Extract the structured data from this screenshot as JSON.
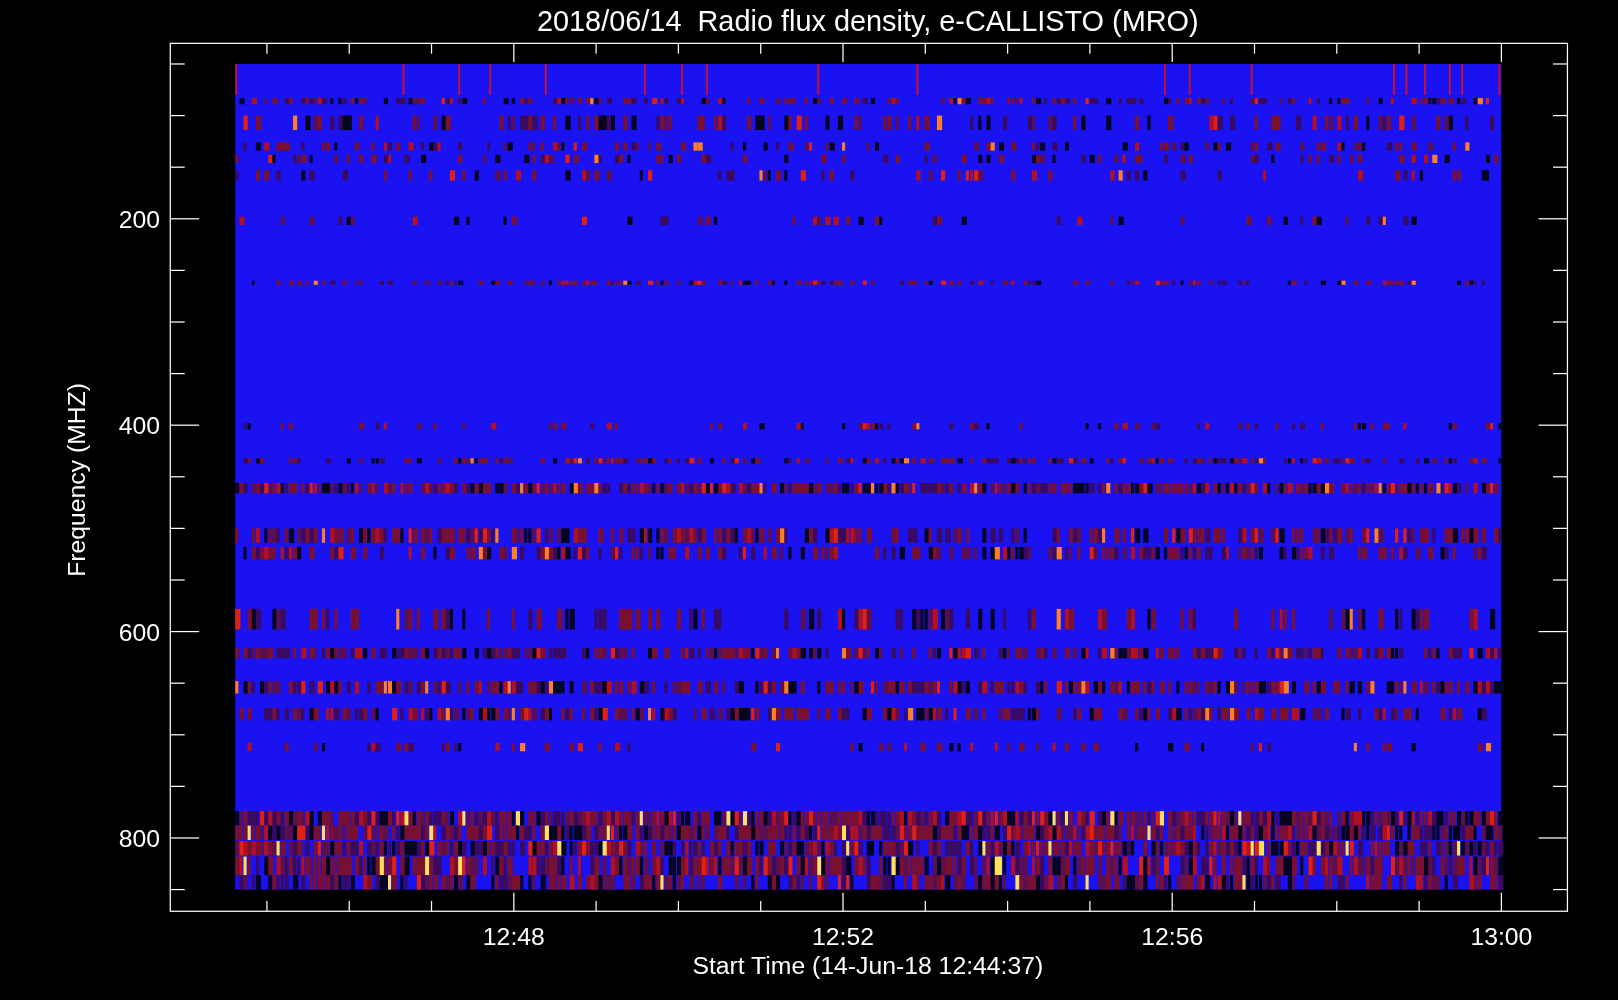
{
  "title": "2018/06/14  Radio flux density, e-CALLISTO (MRO)",
  "xlabel": "Start Time (14-Jun-18 12:44:37)",
  "ylabel": "Frequency (MHZ)",
  "xticks": [
    "12:48",
    "12:52",
    "12:56",
    "13:00"
  ],
  "yticks": [
    "200",
    "400",
    "600",
    "800"
  ]
}
